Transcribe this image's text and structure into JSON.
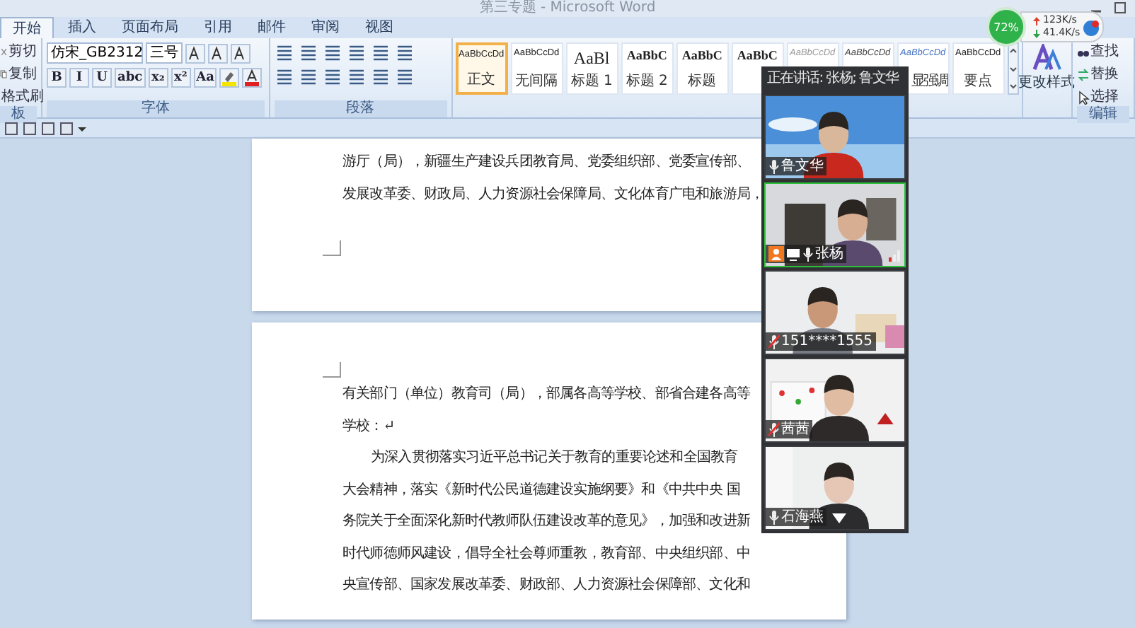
{
  "window": {
    "title": "第三专题 - Microsoft Word"
  },
  "tabs": [
    {
      "label": "开始",
      "selected": true
    },
    {
      "label": "插入",
      "selected": false
    },
    {
      "label": "页面布局",
      "selected": false
    },
    {
      "label": "引用",
      "selected": false
    },
    {
      "label": "邮件",
      "selected": false
    },
    {
      "label": "审阅",
      "selected": false
    },
    {
      "label": "视图",
      "selected": false
    }
  ],
  "clipboard": {
    "items": [
      "剪切",
      "复制",
      "格式刷"
    ],
    "label": "板"
  },
  "font": {
    "name": "仿宋_GB2312",
    "size": "三号",
    "buttons": [
      "B",
      "I",
      "U",
      "abc",
      "x₂",
      "x²",
      "Aa"
    ],
    "label": "字体"
  },
  "paragraph": {
    "label": "段落"
  },
  "styles": [
    {
      "sample": "AaBbCcDd",
      "caption": "正文",
      "selected": true,
      "kind": "small"
    },
    {
      "sample": "AaBbCcDd",
      "caption": "无间隔",
      "selected": false,
      "kind": "small"
    },
    {
      "sample": "AaBl",
      "caption": "标题 1",
      "selected": false,
      "kind": "large"
    },
    {
      "sample": "AaBbC",
      "caption": "标题 2",
      "selected": false,
      "kind": "medium"
    },
    {
      "sample": "AaBbC",
      "caption": "标题",
      "selected": false,
      "kind": "medium"
    },
    {
      "sample": "AaBbC",
      "selected": false,
      "kind": "medium"
    },
    {
      "sample": "AaBbCcDd",
      "selected": false,
      "kind": "faint"
    },
    {
      "sample": "AaBbCcDd",
      "selected": false,
      "kind": "italic"
    },
    {
      "sample": "AaBbCcDd",
      "caption": "显强调",
      "selected": false,
      "kind": "accent"
    },
    {
      "sample": "AaBbCcDd",
      "caption": "要点",
      "selected": false,
      "kind": "small"
    }
  ],
  "change_styles": "更改样式",
  "editing": {
    "items": [
      "查找",
      "替换",
      "选择"
    ],
    "label": "编辑"
  },
  "network": {
    "percent": "72%",
    "upload": "123K/s",
    "download": "41.4K/s"
  },
  "meeting": {
    "header": "正在讲话: 张杨; 鲁文华",
    "participants": [
      {
        "name": "鲁文华",
        "selected": false,
        "host": false,
        "muted": false
      },
      {
        "name": "张杨",
        "selected": true,
        "host": true,
        "muted": false
      },
      {
        "name": "151****1555",
        "selected": false,
        "host": false,
        "muted": true
      },
      {
        "name": "茜茜",
        "selected": false,
        "host": false,
        "muted": true
      },
      {
        "name": "石海燕",
        "selected": false,
        "host": false,
        "muted": false
      }
    ]
  },
  "pages": [
    {
      "paragraphs": [
        {
          "indent": false,
          "lines": [
            "游厅（局），新疆生产建设兵团教育局、党委组织部、党委宣传部、",
            "发展改革委、财政局、人力资源社会保障局、文化体育广电和旅游局，"
          ]
        }
      ]
    },
    {
      "paragraphs": [
        {
          "indent": false,
          "lines": [
            "有关部门（单位）教育司（局），部属各高等学校、部省合建各高等",
            "学校：↵"
          ]
        },
        {
          "indent": true,
          "lines": [
            "为深入贯彻落实习近平总书记关于教育的重要论述和全国教育",
            "大会精神，落实《新时代公民道德建设实施纲要》和《中共中央 国",
            "务院关于全面深化新时代教师队伍建设改革的意见》，加强和改进新",
            "时代师德师风建设，倡导全社会尊师重教，教育部、中央组织部、中",
            "央宣传部、国家发展改革委、财政部、人力资源社会保障部、文化和"
          ]
        }
      ]
    }
  ]
}
